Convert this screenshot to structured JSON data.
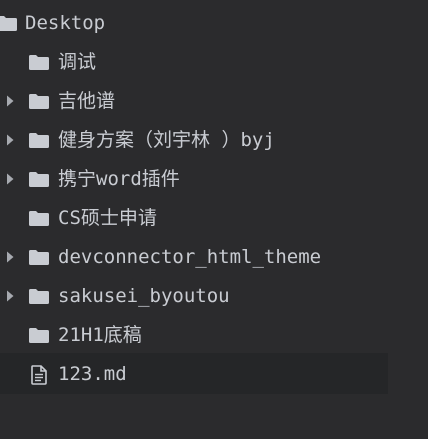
{
  "tree": {
    "root": {
      "label": "Desktop",
      "icon": "folder-icon"
    },
    "items": [
      {
        "label": "调试",
        "type": "folder",
        "icon": "folder-icon",
        "has_chevron": false
      },
      {
        "label": "吉他谱",
        "type": "folder",
        "icon": "folder-icon",
        "has_chevron": true
      },
      {
        "label": "健身方案（刘宇林 ）byj",
        "type": "folder",
        "icon": "folder-icon",
        "has_chevron": true
      },
      {
        "label": "携宁word插件",
        "type": "folder",
        "icon": "folder-icon",
        "has_chevron": true
      },
      {
        "label": "CS硕士申请",
        "type": "folder",
        "icon": "folder-icon",
        "has_chevron": false
      },
      {
        "label": "devconnector_html_theme",
        "type": "folder",
        "icon": "folder-icon",
        "has_chevron": true
      },
      {
        "label": "sakusei_byoutou",
        "type": "folder",
        "icon": "folder-icon",
        "has_chevron": true
      },
      {
        "label": "21H1底稿",
        "type": "folder",
        "icon": "folder-icon",
        "has_chevron": false
      },
      {
        "label": "123.md",
        "type": "file",
        "icon": "file-icon",
        "has_chevron": false,
        "selected": true
      }
    ]
  },
  "colors": {
    "background": "#2b2b2d",
    "selected_row": "#252628",
    "text": "#c9ccd2",
    "icon": "#c9ccd2",
    "chevron": "#a7aab0"
  }
}
